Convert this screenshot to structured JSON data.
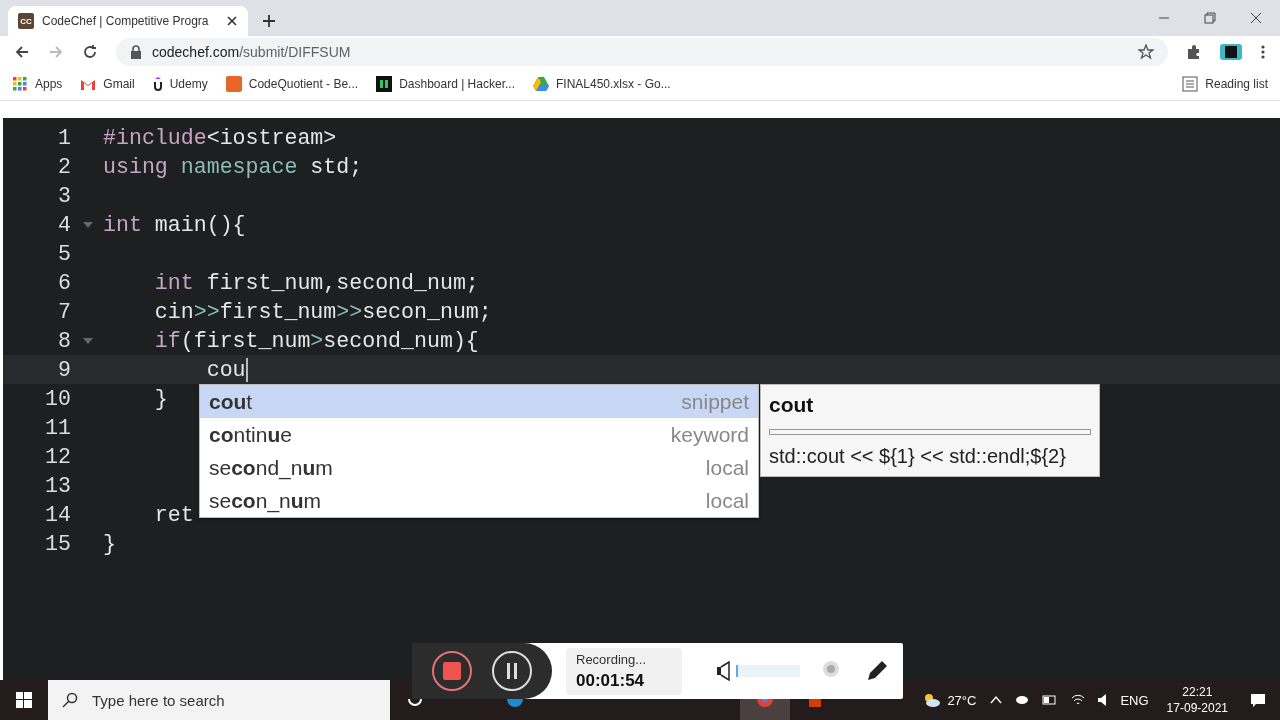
{
  "browser": {
    "tab": {
      "title": "CodeChef | Competitive Progra",
      "favicon": "CC"
    },
    "url": {
      "host": "codechef.com",
      "path": "/submit/DIFFSUM"
    },
    "bookmarks": [
      {
        "kind": "apps",
        "label": "Apps"
      },
      {
        "kind": "gmail",
        "label": "Gmail"
      },
      {
        "kind": "udemy",
        "label": "Udemy"
      },
      {
        "kind": "cq",
        "label": "CodeQuotient - Be..."
      },
      {
        "kind": "hr",
        "label": "Dashboard | Hacker..."
      },
      {
        "kind": "drive",
        "label": "FINAL450.xlsx - Go..."
      }
    ],
    "reading_list": "Reading list"
  },
  "editor": {
    "lines": [
      {
        "number": "1",
        "tokens": [
          {
            "kind": "kw",
            "text": "#include"
          },
          {
            "kind": "txt",
            "text": "<iostream>"
          }
        ]
      },
      {
        "number": "2",
        "tokens": [
          {
            "kind": "kw",
            "text": "using"
          },
          {
            "kind": "ns",
            "text": " namespace"
          },
          {
            "kind": "txt",
            "text": " std;"
          }
        ]
      },
      {
        "number": "3"
      },
      {
        "number": "4",
        "foldable": true,
        "tokens": [
          {
            "kind": "kw",
            "text": "int"
          },
          {
            "kind": "txt",
            "text": " main(){"
          }
        ]
      },
      {
        "number": "5"
      },
      {
        "number": "6",
        "tokens": [
          {
            "kind": "kw",
            "text": "    int"
          },
          {
            "kind": "txt",
            "text": " first_num,second_num;"
          }
        ]
      },
      {
        "number": "7",
        "tokens": [
          {
            "kind": "txt",
            "text": "    cin"
          },
          {
            "kind": "op",
            "text": ">>"
          },
          {
            "kind": "txt",
            "text": "first_num"
          },
          {
            "kind": "op",
            "text": ">>"
          },
          {
            "kind": "txt",
            "text": "secon_num;"
          }
        ]
      },
      {
        "number": "8",
        "foldable": true,
        "tokens": [
          {
            "kind": "kw",
            "text": "    if"
          },
          {
            "kind": "txt",
            "text": "(first_num"
          },
          {
            "kind": "op",
            "text": ">"
          },
          {
            "kind": "txt",
            "text": "second_num){"
          }
        ]
      },
      {
        "number": "9",
        "active": true,
        "cursor": true,
        "tokens": [
          {
            "kind": "txt",
            "text": "        cou"
          }
        ]
      },
      {
        "number": "10",
        "tokens": [
          {
            "kind": "txt",
            "text": "    }"
          }
        ]
      },
      {
        "number": "11"
      },
      {
        "number": "12"
      },
      {
        "number": "13"
      },
      {
        "number": "14",
        "tokens": [
          {
            "kind": "txt",
            "text": "    ret"
          }
        ]
      },
      {
        "number": "15",
        "tokens": [
          {
            "kind": "txt",
            "text": "}"
          }
        ]
      }
    ],
    "autocomplete": {
      "items": [
        {
          "label": "**cou**t",
          "type": "snippet",
          "selected": true
        },
        {
          "label": "**co**ntin**u**e",
          "type": "keyword",
          "selected": false
        },
        {
          "label": "se**co**nd_n**u**m",
          "type": "local",
          "selected": false
        },
        {
          "label": "se**co**n_n**u**m",
          "type": "local",
          "selected": false
        }
      ],
      "doc": {
        "title": "cout",
        "body": "std::cout << ${1} << std::endl;${2}"
      }
    }
  },
  "recorder": {
    "status": "Recording...",
    "time": "00:01:54",
    "level": 0.02
  },
  "taskbar": {
    "search_placeholder": "Type here to search",
    "weather": "27°C",
    "language": "ENG",
    "time": "22:21",
    "date": "17-09-2021"
  }
}
